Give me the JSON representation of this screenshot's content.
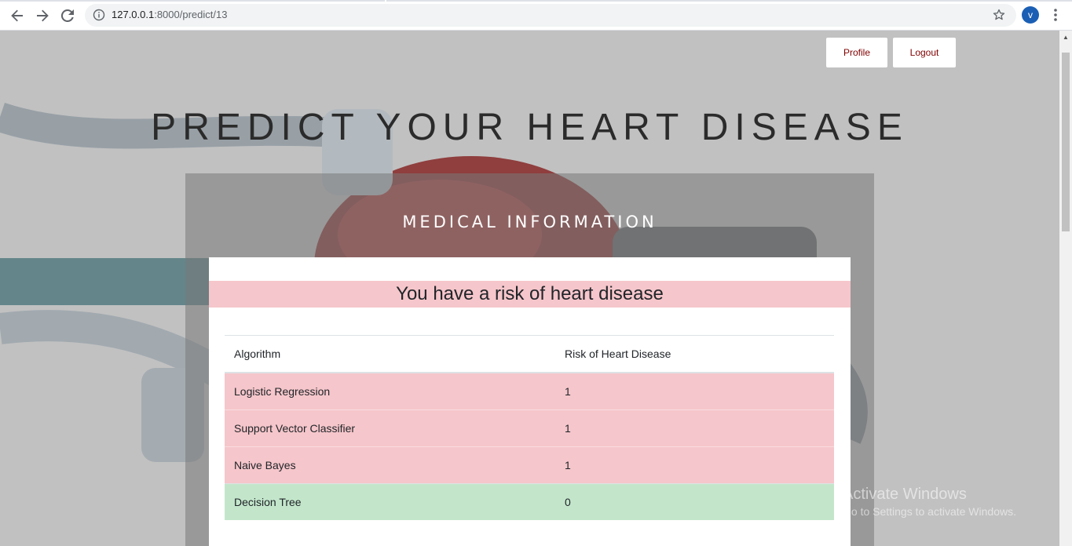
{
  "browser": {
    "url_host": "127.0.0.1",
    "url_rest": ":8000/predict/13",
    "profile_initial": "v"
  },
  "header": {
    "profile_label": "Profile",
    "logout_label": "Logout",
    "headline": "PREDICT YOUR HEART DISEASE"
  },
  "panel": {
    "title": "MEDICAL INFORMATION"
  },
  "result": {
    "message": "You have a risk of heart disease",
    "columns": [
      "Algorithm",
      "Risk of Heart Disease"
    ],
    "rows": [
      {
        "algorithm": "Logistic Regression",
        "risk": "1",
        "status": "danger"
      },
      {
        "algorithm": "Support Vector Classifier",
        "risk": "1",
        "status": "danger"
      },
      {
        "algorithm": "Naive Bayes",
        "risk": "1",
        "status": "danger"
      },
      {
        "algorithm": "Decision Tree",
        "risk": "0",
        "status": "success"
      }
    ]
  },
  "watermark": {
    "line1": "Activate Windows",
    "line2": "Go to Settings to activate Windows."
  },
  "colors": {
    "danger_bg": "#f5c6cb",
    "success_bg": "#c3e6cb",
    "button_text": "#800000"
  }
}
